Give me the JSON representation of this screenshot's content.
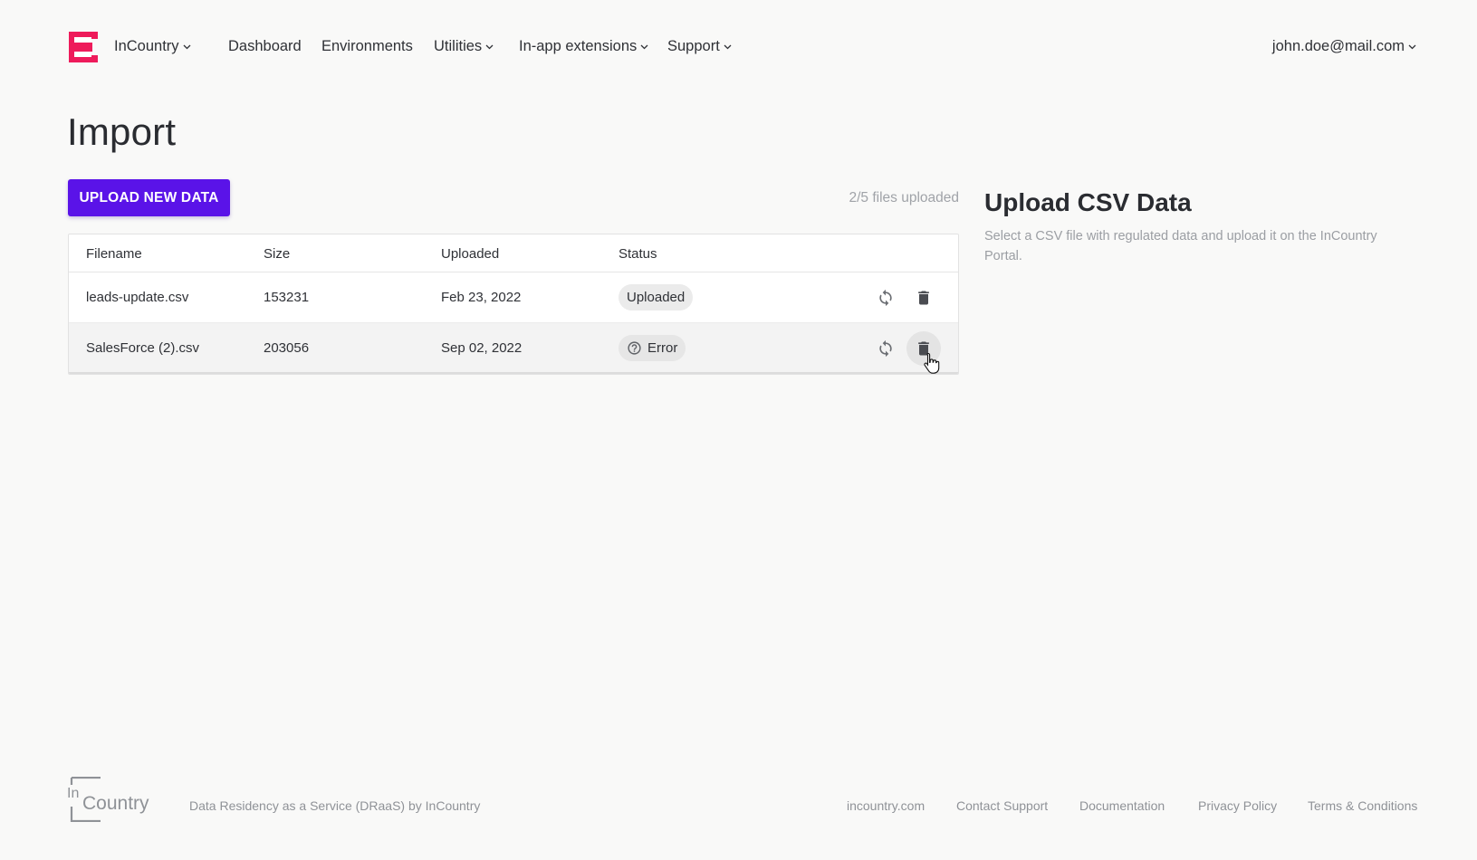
{
  "header": {
    "org_name": "InCountry",
    "nav": {
      "dashboard": "Dashboard",
      "environments": "Environments",
      "utilities": "Utilities",
      "in_app_extensions": "In-app extensions",
      "support": "Support"
    },
    "user_email": "john.doe@mail.com"
  },
  "main": {
    "title": "Import",
    "upload_button": "UPLOAD NEW DATA",
    "files_status": "2/5 files uploaded",
    "table": {
      "columns": [
        "Filename",
        "Size",
        "Uploaded",
        "Status"
      ],
      "rows": [
        {
          "filename": "leads-update.csv",
          "size": "153231",
          "uploaded": "Feb 23, 2022",
          "status": "Uploaded"
        },
        {
          "filename": "SalesForce (2).csv",
          "size": "203056",
          "uploaded": "Sep 02, 2022",
          "status": "Error"
        }
      ]
    }
  },
  "side_panel": {
    "title": "Upload CSV Data",
    "description": "Select a CSV file with regulated data and upload it on the InCountry Portal."
  },
  "footer": {
    "logo_text": {
      "top": "In",
      "bottom": "Country"
    },
    "tagline": "Data Residency as a Service (DRaaS) by InCountry",
    "links": [
      "incountry.com",
      "Contact Support",
      "Documentation",
      "Privacy Policy",
      "Terms & Conditions"
    ]
  },
  "colors": {
    "brand": "#ee1b5b",
    "primary_button": "#5a13e8",
    "background": "#f9f9f8"
  },
  "icons": [
    "incountry-logo-icon",
    "chevron-down-icon",
    "refresh-icon",
    "trash-icon",
    "help-circle-icon",
    "pointer-cursor-icon"
  ]
}
